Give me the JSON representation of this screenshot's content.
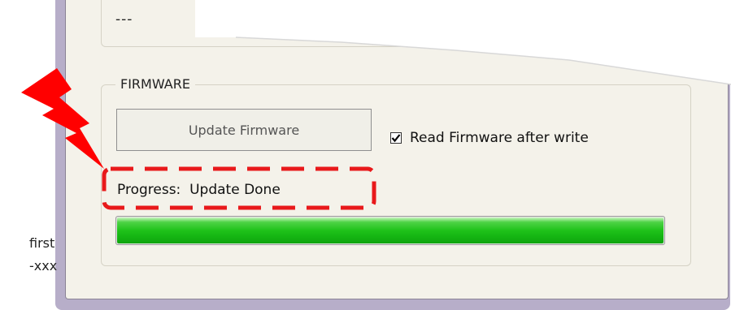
{
  "top_group": {
    "value": "---"
  },
  "firmware": {
    "legend": "FIRMWARE",
    "update_button_label": "Update Firmware",
    "read_after_write": {
      "label": "Read Firmware after write",
      "checked": true
    },
    "progress": {
      "label_prefix": "Progress:",
      "status": "Update Done",
      "fraction": 1.0
    }
  },
  "side_annotation": {
    "line1": "first",
    "line2": "-xxx"
  },
  "colors": {
    "highlight": "#e8191b",
    "progress_fill": "#1fc21a",
    "lightning": "#ff0000",
    "window_frame": "#b7aec9"
  }
}
